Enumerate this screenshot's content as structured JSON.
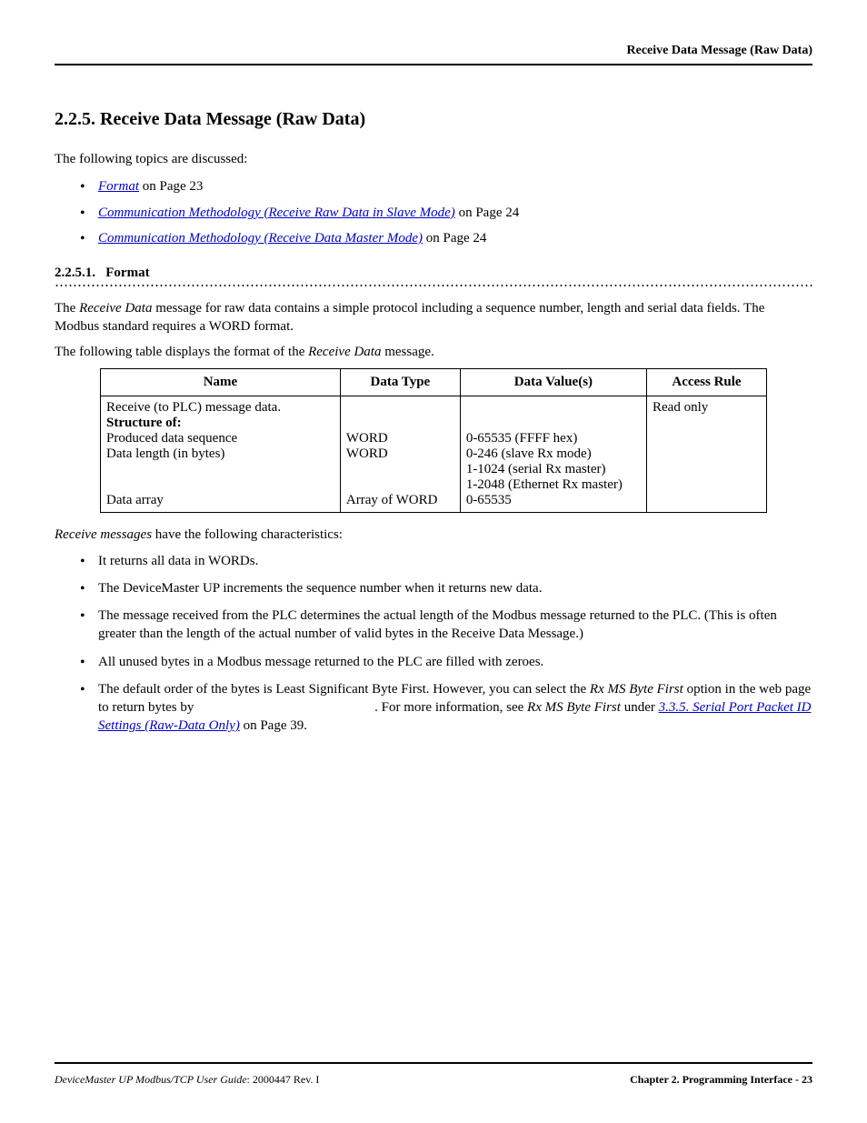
{
  "header": {
    "running_title": "Receive Data Message (Raw Data)"
  },
  "section": {
    "number": "2.2.5.",
    "title": "Receive Data Message (Raw Data)"
  },
  "intro": "The following topics are discussed:",
  "toc": [
    {
      "link": "Format",
      "tail": " on Page 23"
    },
    {
      "link": "Communication Methodology (Receive Raw Data in Slave Mode)",
      "tail": " on Page 24"
    },
    {
      "link": "Communication Methodology (Receive Data Master Mode)",
      "tail": " on Page 24"
    }
  ],
  "sub": {
    "number": "2.2.5.1.",
    "title": "Format"
  },
  "p1_pre": "The ",
  "p1_em": "Receive Data",
  "p1_post": " message for raw data contains a simple protocol including a sequence number, length and serial data fields. The Modbus standard requires a WORD format.",
  "p2_pre": "The following table displays the format of the ",
  "p2_em": "Receive Data",
  "p2_post": " message.",
  "table": {
    "headers": [
      "Name",
      "Data Type",
      "Data Value(s)",
      "Access Rule"
    ],
    "row1": {
      "name_line1": "Receive (to PLC) message data.",
      "name_line2": "Structure of:",
      "name_line3": "Produced data sequence",
      "name_line4": "Data length (in bytes)",
      "name_empty": "",
      "name_line5": "Data array",
      "type_line1": "",
      "type_line2": "",
      "type_line3": "WORD",
      "type_line4": "WORD",
      "type_empty": "",
      "type_line5": "Array of WORD",
      "val_line1": "",
      "val_line2": "",
      "val_line3": "0-65535 (FFFF hex)",
      "val_line4": "0-246 (slave Rx mode)",
      "val_line4b": "1-1024 (serial Rx master)",
      "val_line4c": "1-2048 (Ethernet Rx master)",
      "val_line5": "0-65535",
      "rule": "Read only"
    }
  },
  "char_intro_em": "Receive messages",
  "char_intro_post": " have the following characteristics:",
  "characteristics": [
    "It returns all data in WORDs.",
    "The DeviceMaster UP increments the sequence number when it returns new data.",
    "The message received from the PLC determines the actual length of the Modbus message returned to the PLC. (This is often greater than the length of the actual number of valid bytes in the Receive Data Message.)",
    "All unused bytes in a Modbus message returned to the PLC are filled with zeroes."
  ],
  "char5": {
    "t1": "The default order of the bytes is Least Significant Byte First. However, you can select the ",
    "em1": "Rx MS Byte First",
    "t2": " option in the web page to return bytes by ",
    "gap": "                                                    ",
    "t3": ". For more information, see ",
    "em2": "Rx MS Byte First",
    "t4": " under ",
    "link": "3.3.5. Serial Port Packet ID Settings (Raw-Data Only)",
    "t5": " on Page 39."
  },
  "footer": {
    "left_em": "DeviceMaster UP Modbus/TCP User Guide",
    "left_tail": ": 2000447 Rev. I",
    "right": "Chapter 2. Programming Interface - 23"
  }
}
